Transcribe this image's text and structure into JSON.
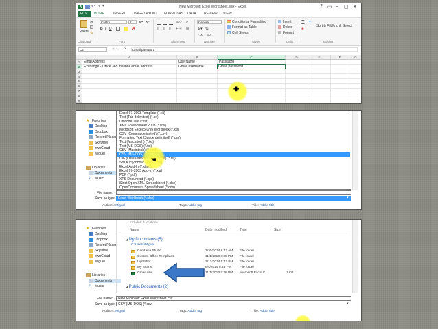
{
  "excel": {
    "window_title": "New Microsoft Excel Worksheet.xlsx - Excel",
    "window_controls": [
      "?",
      "▭",
      "–",
      "▢",
      "✕"
    ],
    "tabs": [
      "FILE",
      "HOME",
      "INSERT",
      "PAGE LAYOUT",
      "FORMULAS",
      "DATA",
      "REVIEW",
      "VIEW"
    ],
    "ribbon": {
      "paste": "Paste",
      "font_name": "Calibri",
      "font_size": "11",
      "number_format": "General",
      "conditional_formatting": "Conditional Formatting",
      "format_as_table": "Format as Table",
      "cell_styles": "Cell Styles",
      "insert": "Insert",
      "delete": "Delete",
      "format": "Format",
      "sort_filter": "Sort & Filter",
      "find_select": "Find & Select",
      "group_labels": [
        "Clipboard",
        "Font",
        "Alignment",
        "Number",
        "Styles",
        "Cells",
        "Editing"
      ]
    },
    "name_box": "C2",
    "fx": "fx",
    "formula_value": "Gmail password",
    "columns": [
      "A",
      "B",
      "C",
      "D",
      "E",
      "F",
      "G"
    ],
    "rows": [
      "1",
      "2",
      "3",
      "4",
      "5",
      "6",
      "7",
      "8",
      "9",
      "10"
    ],
    "cells": {
      "a1": "EmailAddress",
      "b1": "UserName",
      "c1": "Password",
      "a2": "Exchange - Office 365 mailbox email address",
      "b2": "Gmail username",
      "c2": "Gmail password"
    }
  },
  "dialog_save_type": {
    "nav": [
      "Favorites",
      "Desktop",
      "Dropbox",
      "Recent Places",
      "SkyDrive",
      "ownCloud",
      "Miguel",
      "Libraries",
      "Documents",
      "Music"
    ],
    "file_types": [
      "Excel 97-2003 Template (*.xlt)",
      "Text (Tab delimited) (*.txt)",
      "Unicode Text (*.txt)",
      "XML Spreadsheet 2003 (*.xml)",
      "Microsoft Excel 5.0/95 Workbook (*.xls)",
      "CSV (Comma delimited) (*.csv)",
      "Formatted Text (Space delimited) (*.prn)",
      "Text (Macintosh) (*.txt)",
      "Text (MS-DOS) (*.txt)",
      "CSV (Macintosh) (*.csv)",
      "CSV (MS-DOS) (*.csv)",
      "DIF (Data Interchange Format) (*.dif)",
      "SYLK (Symbolic Link) (*.slk)",
      "Excel Add-In (*.xlam)",
      "Excel 97-2003 Add-In (*.xla)",
      "PDF (*.pdf)",
      "XPS Document (*.xps)",
      "Strict Open XML Spreadsheet (*.xlsx)",
      "OpenDocument Spreadsheet (*.ods)"
    ],
    "selected_index": 10,
    "file_name_label": "File name:",
    "save_type_label": "Save as type:",
    "save_type_value": "Excel Workbook (*.xlsx)",
    "authors_label": "Authors:",
    "authors_value": "Miguel",
    "tags_label": "Tags:",
    "tags_value": "Add a tag",
    "title_label": "Title:",
    "title_value": "Add a title"
  },
  "dialog_save_location": {
    "nav": [
      "Favorites",
      "Desktop",
      "Dropbox",
      "Recent Places",
      "SkyDrive",
      "ownCloud",
      "Miguel",
      "Libraries",
      "Documents",
      "Music"
    ],
    "includes": "Includes: 4 locations",
    "columns": [
      "Name",
      "Date modified",
      "Type",
      "Size"
    ],
    "group1": "My Documents (5)",
    "group1_path": "C:\\Users\\Miguel",
    "files": [
      {
        "name": "Camtasia Studio",
        "date": "7/30/2014 8:43 AM",
        "type": "File folder",
        "size": ""
      },
      {
        "name": "Custom Office Templates",
        "date": "11/1/2013 3:05 PM",
        "type": "File folder",
        "size": ""
      },
      {
        "name": "Lightshot",
        "date": "2/12/2014 5:47 PM",
        "type": "File folder",
        "size": ""
      },
      {
        "name": "My Scans",
        "date": "6/4/2014 8:43 PM",
        "type": "File folder",
        "size": ""
      },
      {
        "name": "Gmail.csv",
        "date": "11/1/2013 7:28 PM",
        "type": "Microsoft Excel C...",
        "size": "1 KB"
      }
    ],
    "group2": "Public Documents (2)",
    "file_name_label": "File name:",
    "file_name_value": "New Microsoft Excel Worksheet.csv",
    "save_type_label": "Save as type:",
    "save_type_value": "CSV (MS-DOS) (*.csv)",
    "authors_label": "Authors:",
    "authors_value": "Miguel",
    "tags_label": "Tags:",
    "tags_value": "Add a tag",
    "title_label": "Title:",
    "title_value": "Add a title"
  },
  "colors": {
    "excel_green": "#217346",
    "selection_blue": "#3399ff",
    "arrow_blue": "#3b78c8",
    "highlight_yellow": "#fff85a"
  }
}
